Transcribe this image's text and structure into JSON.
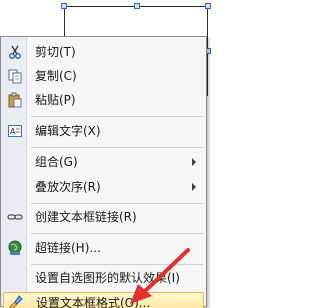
{
  "menu": {
    "items": [
      {
        "icon": "scissors-icon",
        "label": "剪切(T)"
      },
      {
        "icon": "copy-icon",
        "label": "复制(C)"
      },
      {
        "icon": "paste-icon",
        "label": "粘贴(P)"
      },
      {
        "icon": "edit-text-icon",
        "label": "编辑文字(X)"
      },
      {
        "label": "组合(G)",
        "submenu": true
      },
      {
        "label": "叠放次序(R)",
        "submenu": true
      },
      {
        "icon": "chain-link-icon",
        "label": "创建文本框链接(R)"
      },
      {
        "icon": "hyperlink-globe-icon",
        "label": "超链接(H)..."
      },
      {
        "label": "设置自选图形的默认效果(I)"
      },
      {
        "icon": "format-textbox-icon",
        "label": "设置文本框格式(O)...",
        "highlighted": true
      }
    ]
  },
  "colors": {
    "highlight": "#ffe69a",
    "pointer": "#e0322a"
  }
}
